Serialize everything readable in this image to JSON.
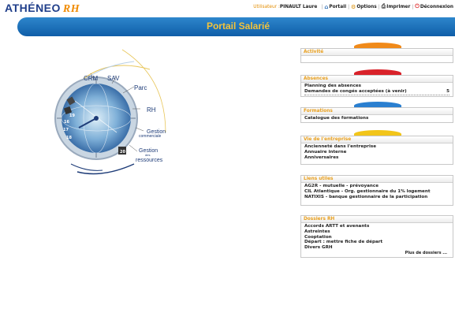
{
  "header": {
    "logo_main": "ATHÉNEO",
    "logo_suffix": "RH",
    "user_label": "Utilisateur : ",
    "user_name": "PINAULT Laure",
    "nav": [
      {
        "label": "Portail",
        "icon": "home-icon"
      },
      {
        "label": "Options",
        "icon": "gear-icon"
      },
      {
        "label": "Imprimer",
        "icon": "printer-icon"
      },
      {
        "label": "Déconnexion",
        "icon": "power-icon"
      }
    ]
  },
  "banner": {
    "title": "Portail Salarié"
  },
  "illustration": {
    "labels": [
      "CRM",
      "SAV",
      "Parc",
      "RH",
      "Gestion",
      "commerciale",
      "Gestion",
      "des",
      "ressources"
    ],
    "clock_numbers": [
      "16",
      "17",
      "18",
      "19",
      "20"
    ],
    "icon": "clock-globe-icon"
  },
  "panels": {
    "activite": {
      "title": "Activité",
      "items": []
    },
    "absences": {
      "title": "Absences",
      "items": [
        {
          "label": "Planning des absences",
          "count": ""
        },
        {
          "label": "Demandes de congés acceptées (à venir)",
          "count": "5"
        }
      ]
    },
    "formations": {
      "title": "Formations",
      "items": [
        {
          "label": "Catalogue des formations"
        }
      ]
    },
    "vie": {
      "title": "Vie de l'entreprise",
      "items": [
        {
          "label": "Ancienneté dans l'entreprise"
        },
        {
          "label": "Annuaire interne"
        },
        {
          "label": "Anniversaires"
        }
      ]
    },
    "liens": {
      "title": "Liens utiles",
      "items": [
        {
          "label": "AG2R - mutuelle - prévoyance"
        },
        {
          "label": "CIL Atlantique - Org. gestionnaire du 1% logement"
        },
        {
          "label": "NATIXIS - banque gestionnaire de la participation"
        }
      ]
    },
    "dossiers": {
      "title": "Dossiers RH",
      "items": [
        {
          "label": "Accords ARTT et avenants"
        },
        {
          "label": "Astreintes"
        },
        {
          "label": "Cooptation"
        },
        {
          "label": "Départ : mettre fiche de départ"
        },
        {
          "label": "Divers GRH"
        }
      ],
      "more": "Plus de dossiers ..."
    }
  },
  "colors": {
    "accent_orange": "#f08a1a",
    "banner_blue": "#0f5ea8",
    "title_yellow": "#f4c33a",
    "head_text": "#e8a020"
  }
}
